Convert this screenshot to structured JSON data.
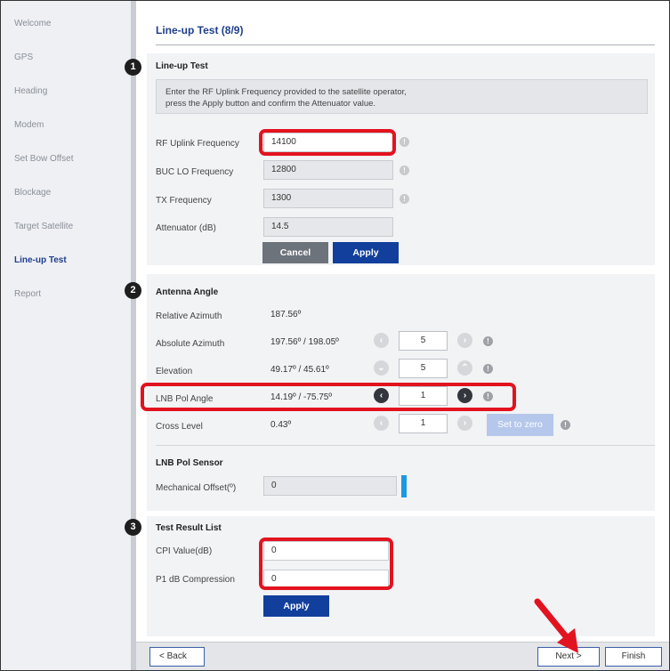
{
  "sidebar": {
    "items": [
      {
        "label": "Welcome"
      },
      {
        "label": "GPS"
      },
      {
        "label": "Heading"
      },
      {
        "label": "Modem"
      },
      {
        "label": "Set Bow Offset"
      },
      {
        "label": "Blockage"
      },
      {
        "label": "Target Satellite"
      },
      {
        "label": "Line-up Test",
        "active": true
      },
      {
        "label": "Report"
      }
    ]
  },
  "page": {
    "title": "Line-up Test (8/9)"
  },
  "lineup": {
    "badge": "1",
    "title": "Line-up Test",
    "info_line1": "Enter the RF Uplink Frequency provided to the satellite operator,",
    "info_line2": "press the Apply button and confirm the Attenuator value.",
    "rf_label": "RF Uplink Frequency",
    "rf_value": "14100",
    "buc_label": "BUC LO Frequency",
    "buc_value": "12800",
    "tx_label": "TX Frequency",
    "tx_value": "1300",
    "att_label": "Attenuator (dB)",
    "att_value": "14.5",
    "cancel_label": "Cancel",
    "apply_label": "Apply"
  },
  "antenna": {
    "badge": "2",
    "title": "Antenna Angle",
    "rel_az_label": "Relative Azimuth",
    "rel_az_value": "187.56º",
    "abs_az_label": "Absolute Azimuth",
    "abs_az_value": "197.56º / 198.05º",
    "abs_az_step": "5",
    "elev_label": "Elevation",
    "elev_value": "49.17º / 45.61º",
    "elev_step": "5",
    "lnb_label": "LNB Pol Angle",
    "lnb_value": "14.19º / -75.75º",
    "lnb_step": "1",
    "cross_label": "Cross Level",
    "cross_value": "0.43º",
    "cross_step": "1",
    "set_zero_label": "Set to zero"
  },
  "pol_sensor": {
    "title": "LNB Pol Sensor",
    "mech_label": "Mechanical Offset(º)",
    "mech_value": "0"
  },
  "results": {
    "badge": "3",
    "title": "Test Result List",
    "cpi_label": "CPI Value(dB)",
    "cpi_value": "0",
    "p1_label": "P1 dB Compression",
    "p1_value": "0",
    "apply_label": "Apply"
  },
  "footer": {
    "back_label": "< Back",
    "next_label": "Next >",
    "finish_label": "Finish"
  },
  "colors": {
    "highlight": "#e2131f",
    "accent": "#123f9c"
  }
}
